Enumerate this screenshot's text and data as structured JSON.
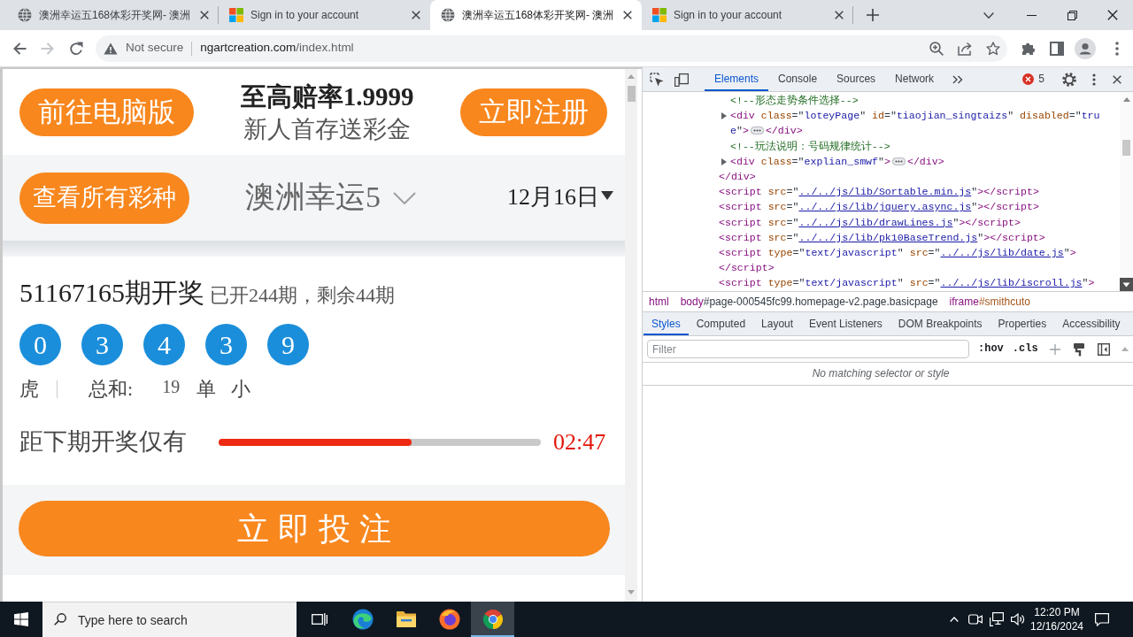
{
  "browser": {
    "tabs": [
      {
        "kind": "site",
        "title": "澳洲幸运五168体彩开奖网- 澳洲",
        "selected": false
      },
      {
        "kind": "microsoft",
        "title": "Sign in to your account",
        "selected": false
      },
      {
        "kind": "site",
        "title": "澳洲幸运五168体彩开奖网- 澳洲",
        "selected": true
      },
      {
        "kind": "microsoft",
        "title": "Sign in to your account",
        "selected": false
      }
    ],
    "nav_buttons": [
      {
        "kind": "back",
        "disabled": false
      },
      {
        "kind": "forward",
        "disabled": true
      },
      {
        "kind": "reload",
        "disabled": false
      }
    ],
    "address_bar": {
      "security": "Not secure",
      "host": "ngartcreation.com",
      "path": "/index.html"
    }
  },
  "page": {
    "header": {
      "desktop_button": "前往电脑版",
      "promo_title": "至高赔率1.9999",
      "promo_subtitle": "新人首存送彩金",
      "register_button": "立即注册"
    },
    "selector_bar": {
      "all_lotteries_button": "查看所有彩种",
      "lottery": "澳洲幸运5",
      "date": "12月16日"
    },
    "draw": {
      "issue": "51167165期开奖",
      "progress_note": "已开244期，剩余44期",
      "balls": [
        "0",
        "3",
        "4",
        "3",
        "9"
      ],
      "dragon_tiger": "虎",
      "sum_label": "总和:",
      "sum": "19",
      "odd_even": "单",
      "big_small": "小"
    },
    "countdown": {
      "label": "距下期开奖仅有",
      "level": 0.6,
      "time": "02:47"
    },
    "bet_button": "立即投注"
  },
  "devtools": {
    "tabs": [
      {
        "label": "Elements",
        "selected": true
      },
      {
        "label": "Console",
        "selected": false
      },
      {
        "label": "Sources",
        "selected": false
      },
      {
        "label": "Network",
        "selected": false
      }
    ],
    "error_count": "5",
    "dom": [
      {
        "children": [
          {
            "open": [
              {
                "kind": "comment",
                "text": "<!--形态走势条件选择-->"
              }
            ]
          },
          {
            "open": [
              {
                "kind": "tag",
                "text": "<div"
              },
              {
                "kind": "attr",
                "text": " class"
              },
              {
                "kind": "punct",
                "text": "=\""
              },
              {
                "kind": "value",
                "text": "loteyPage"
              },
              {
                "kind": "punct",
                "text": "\""
              },
              {
                "kind": "attr",
                "text": " id"
              },
              {
                "kind": "punct",
                "text": "=\""
              },
              {
                "kind": "value",
                "text": "tiaojian_singtaizs"
              },
              {
                "kind": "punct",
                "text": "\""
              },
              {
                "kind": "attr",
                "text": " disabled"
              },
              {
                "kind": "punct",
                "text": "=\""
              },
              {
                "kind": "value",
                "text": "true"
              },
              {
                "kind": "punct",
                "text": "\""
              },
              {
                "kind": "tag",
                "text": ">"
              }
            ],
            "collapsed": true,
            "close": [
              {
                "kind": "tag",
                "text": "</div>"
              }
            ]
          },
          {
            "open": [
              {
                "kind": "comment",
                "text": "<!--玩法说明：号码规律统计-->"
              }
            ]
          },
          {
            "open": [
              {
                "kind": "tag",
                "text": "<div"
              },
              {
                "kind": "attr",
                "text": " class"
              },
              {
                "kind": "punct",
                "text": "=\""
              },
              {
                "kind": "value",
                "text": "explian_smwf"
              },
              {
                "kind": "punct",
                "text": "\""
              },
              {
                "kind": "tag",
                "text": ">"
              }
            ],
            "collapsed": true,
            "close": [
              {
                "kind": "tag",
                "text": "</div>"
              }
            ]
          }
        ],
        "close": [
          {
            "kind": "tag",
            "text": "</div>"
          }
        ]
      },
      {
        "open": [
          {
            "kind": "tag",
            "text": "<script"
          },
          {
            "kind": "attr",
            "text": " src"
          },
          {
            "kind": "punct",
            "text": "=\""
          },
          {
            "kind": "link",
            "text": "../../js/lib/Sortable.min.js"
          },
          {
            "kind": "punct",
            "text": "\""
          },
          {
            "kind": "tag",
            "text": ">"
          }
        ],
        "close": [
          {
            "kind": "tag",
            "text": "</script>"
          }
        ]
      },
      {
        "open": [
          {
            "kind": "tag",
            "text": "<script"
          },
          {
            "kind": "attr",
            "text": " src"
          },
          {
            "kind": "punct",
            "text": "=\""
          },
          {
            "kind": "link",
            "text": "../../js/lib/jquery.async.js"
          },
          {
            "kind": "punct",
            "text": "\""
          },
          {
            "kind": "tag",
            "text": ">"
          }
        ],
        "close": [
          {
            "kind": "tag",
            "text": "</script>"
          }
        ]
      },
      {
        "open": [
          {
            "kind": "tag",
            "text": "<script"
          },
          {
            "kind": "attr",
            "text": " src"
          },
          {
            "kind": "punct",
            "text": "=\""
          },
          {
            "kind": "link",
            "text": "../../js/lib/drawLines.js"
          },
          {
            "kind": "punct",
            "text": "\""
          },
          {
            "kind": "tag",
            "text": ">"
          }
        ],
        "close": [
          {
            "kind": "tag",
            "text": "</script>"
          }
        ]
      },
      {
        "open": [
          {
            "kind": "tag",
            "text": "<script"
          },
          {
            "kind": "attr",
            "text": " src"
          },
          {
            "kind": "punct",
            "text": "=\""
          },
          {
            "kind": "link",
            "text": "../../js/lib/pk10BaseTrend.js"
          },
          {
            "kind": "punct",
            "text": "\""
          },
          {
            "kind": "tag",
            "text": ">"
          }
        ],
        "close": [
          {
            "kind": "tag",
            "text": "</script>"
          }
        ]
      },
      {
        "open": [
          {
            "kind": "tag",
            "text": "<script"
          },
          {
            "kind": "attr",
            "text": " type"
          },
          {
            "kind": "punct",
            "text": "=\""
          },
          {
            "kind": "value",
            "text": "text/javascript"
          },
          {
            "kind": "punct",
            "text": "\""
          },
          {
            "kind": "attr",
            "text": " src"
          },
          {
            "kind": "punct",
            "text": "=\""
          },
          {
            "kind": "link",
            "text": "../../js/lib/date.js"
          },
          {
            "kind": "punct",
            "text": "\""
          },
          {
            "kind": "tag",
            "text": ">"
          }
        ],
        "close": [
          {
            "kind": "tag",
            "text": "</script>"
          }
        ]
      },
      {
        "open": [
          {
            "kind": "tag",
            "text": "<script"
          },
          {
            "kind": "attr",
            "text": " type"
          },
          {
            "kind": "punct",
            "text": "=\""
          },
          {
            "kind": "value",
            "text": "text/javascript"
          },
          {
            "kind": "punct",
            "text": "\""
          },
          {
            "kind": "attr",
            "text": " src"
          },
          {
            "kind": "punct",
            "text": "=\""
          },
          {
            "kind": "link",
            "text": "../../js/lib/iscroll.js"
          },
          {
            "kind": "punct",
            "text": "\""
          },
          {
            "kind": "tag",
            "text": ">"
          }
        ]
      }
    ],
    "breadcrumbs": [
      {
        "tag": "html"
      },
      {
        "tag": "body",
        "selector": "#page-000545fc99.homepage-v2.page.basicpage",
        "color": "#303942"
      },
      {
        "tag": "iframe",
        "selector": "#smithcuto",
        "color": "#a4561b"
      }
    ],
    "sidebar_tabs": [
      {
        "label": "Styles",
        "selected": true
      },
      {
        "label": "Computed",
        "selected": false
      },
      {
        "label": "Layout",
        "selected": false
      },
      {
        "label": "Event Listeners",
        "selected": false
      },
      {
        "label": "DOM Breakpoints",
        "selected": false
      },
      {
        "label": "Properties",
        "selected": false
      },
      {
        "label": "Accessibility",
        "selected": false
      }
    ],
    "filter": {
      "placeholder": "Filter"
    },
    "style_toggles": [
      ":hov",
      ".cls"
    ],
    "empty_message": "No matching selector or style"
  },
  "taskbar": {
    "search": {
      "placeholder": "Type here to search"
    },
    "apps": [
      {
        "kind": "taskview",
        "selected": false
      },
      {
        "kind": "edge",
        "selected": false
      },
      {
        "kind": "explorer",
        "selected": false
      },
      {
        "kind": "firefox",
        "selected": false
      },
      {
        "kind": "chrome",
        "selected": true
      }
    ],
    "time": "12:20 PM",
    "date": "12/16/2024"
  }
}
